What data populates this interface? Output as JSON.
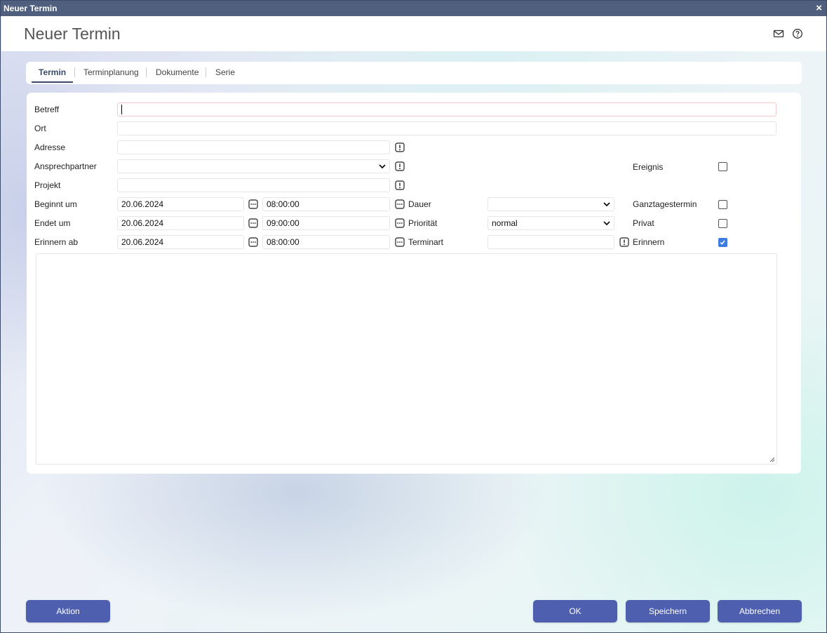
{
  "window": {
    "title": "Neuer Termin",
    "close_glyph": "×"
  },
  "header": {
    "title": "Neuer Termin",
    "icons": [
      "mail-icon",
      "help-icon"
    ]
  },
  "tabs": [
    {
      "label": "Termin",
      "active": true
    },
    {
      "label": "Terminplanung",
      "active": false
    },
    {
      "label": "Dokumente",
      "active": false
    },
    {
      "label": "Serie",
      "active": false
    }
  ],
  "form": {
    "betreff": {
      "label": "Betreff",
      "value": ""
    },
    "ort": {
      "label": "Ort",
      "value": ""
    },
    "adresse": {
      "label": "Adresse",
      "value": ""
    },
    "ansprechpartner": {
      "label": "Ansprechpartner",
      "value": ""
    },
    "projekt": {
      "label": "Projekt",
      "value": ""
    },
    "beginnt": {
      "label": "Beginnt um",
      "date": "20.06.2024",
      "time": "08:00:00"
    },
    "endet": {
      "label": "Endet um",
      "date": "20.06.2024",
      "time": "09:00:00"
    },
    "erinnern_ab": {
      "label": "Erinnern ab",
      "date": "20.06.2024",
      "time": "08:00:00"
    },
    "dauer": {
      "label": "Dauer",
      "value": ""
    },
    "prioritaet": {
      "label": "Priorität",
      "value": "normal"
    },
    "terminart": {
      "label": "Terminart",
      "value": ""
    },
    "ereignis": {
      "label": "Ereignis",
      "checked": false
    },
    "ganztagestermin": {
      "label": "Ganztagestermin",
      "checked": false
    },
    "privat": {
      "label": "Privat",
      "checked": false
    },
    "erinnern": {
      "label": "Erinnern",
      "checked": true
    },
    "notes": ""
  },
  "buttons": {
    "aktion": "Aktion",
    "ok": "OK",
    "speichern": "Speichern",
    "abbrechen": "Abbrechen"
  },
  "colors": {
    "titlebar": "#4f5f7d",
    "button": "#4d5fae",
    "checkbox_checked": "#3f7be0",
    "active_tab": "#3a4a6b"
  }
}
